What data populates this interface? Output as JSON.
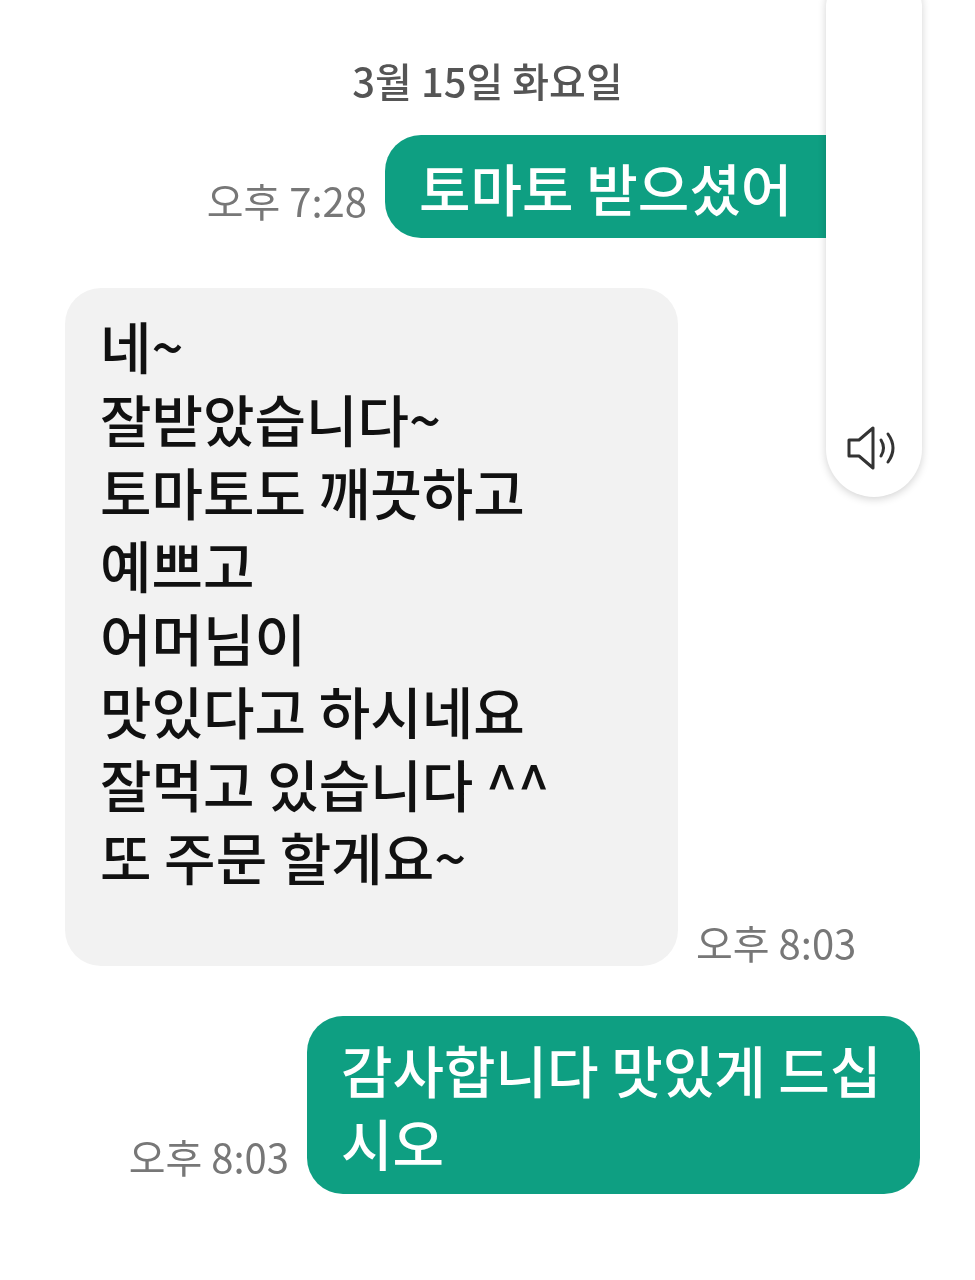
{
  "date_header": "3월 15일 화요일",
  "messages": [
    {
      "kind": "sent",
      "text": "토마토 받으셨어",
      "time": "오후 7:28"
    },
    {
      "kind": "received",
      "text": "네~\n잘받았습니다~\n토마토도 깨끗하고\n예쁘고\n어머님이\n맛있다고 하시네요\n잘먹고 있습니다 ^^\n또 주문 할게요~",
      "time": "오후 8:03"
    },
    {
      "kind": "sent",
      "text": "감사합니다 맛있게 드십시오",
      "time": "오후 8:03"
    }
  ]
}
